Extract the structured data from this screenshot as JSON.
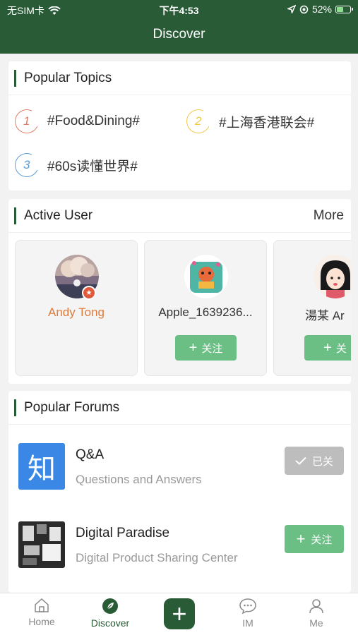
{
  "status_bar": {
    "carrier": "无SIM卡",
    "time": "下午4:53",
    "battery": "52%",
    "battery_level": 0.52
  },
  "header": {
    "title": "Discover"
  },
  "popular_topics": {
    "title": "Popular Topics",
    "items": [
      {
        "rank": "1",
        "label": "#Food&Dining#",
        "color": "#e07a63"
      },
      {
        "rank": "2",
        "label": "#上海香港联会#",
        "color": "#f0c94a"
      },
      {
        "rank": "3",
        "label": "#60s读懂世界#",
        "color": "#5b9bd5"
      }
    ]
  },
  "active_user": {
    "title": "Active User",
    "more": "More",
    "users": [
      {
        "name": "Andy Tong",
        "name_color": "#e07a3a",
        "follow": null
      },
      {
        "name": "Apple_1639236...",
        "name_color": "#333333",
        "follow": "关注"
      },
      {
        "name": "湯某 Ar",
        "name_color": "#333333",
        "follow": "关"
      }
    ]
  },
  "popular_forums": {
    "title": "Popular Forums",
    "items": [
      {
        "icon_text": "知",
        "name": "Q&A",
        "desc": "Questions and Answers",
        "button": "已关",
        "button_state": "followed"
      },
      {
        "icon_text": "",
        "name": "Digital Paradise",
        "desc": "Digital Product Sharing Center",
        "button": "关注",
        "button_state": "follow"
      }
    ]
  },
  "tabbar": {
    "items": [
      {
        "label": "Home"
      },
      {
        "label": "Discover"
      },
      {
        "label": "IM"
      },
      {
        "label": "Me"
      }
    ]
  },
  "colors": {
    "brand": "#2a5b37",
    "follow_green": "#6cbf84",
    "followed_gray": "#bdbdbd"
  }
}
